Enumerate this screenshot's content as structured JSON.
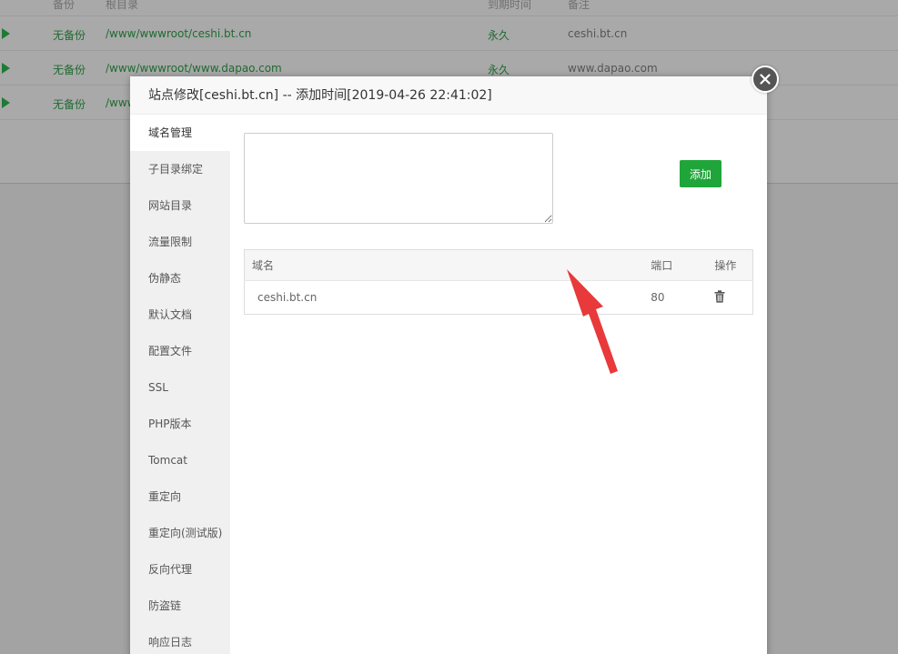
{
  "background": {
    "header": [
      "备份",
      "根目录",
      "到期时间",
      "备注"
    ],
    "rows": [
      {
        "backup": "无备份",
        "path": "/www/wwwroot/ceshi.bt.cn",
        "expire": "永久",
        "note": "ceshi.bt.cn"
      },
      {
        "backup": "无备份",
        "path": "/www/wwwroot/www.dapao.com",
        "expire": "永久",
        "note": "www.dapao.com"
      },
      {
        "backup": "无备份",
        "path": "/www",
        "expire": "",
        "note": ""
      }
    ]
  },
  "modal": {
    "title": "站点修改[ceshi.bt.cn] -- 添加时间[2019-04-26 22:41:02]",
    "sidebar": [
      "域名管理",
      "子目录绑定",
      "网站目录",
      "流量限制",
      "伪静态",
      "默认文档",
      "配置文件",
      "SSL",
      "PHP版本",
      "Tomcat",
      "重定向",
      "重定向(测试版)",
      "反向代理",
      "防盗链",
      "响应日志"
    ],
    "active_index": 0,
    "textarea_value": "",
    "add_button": "添加",
    "table": {
      "headers": {
        "name": "域名",
        "port": "端口",
        "op": "操作"
      },
      "rows": [
        {
          "name": "ceshi.bt.cn",
          "port": "80"
        }
      ]
    }
  },
  "colors": {
    "accent": "#20a53a",
    "arrow": "#e8393b"
  }
}
